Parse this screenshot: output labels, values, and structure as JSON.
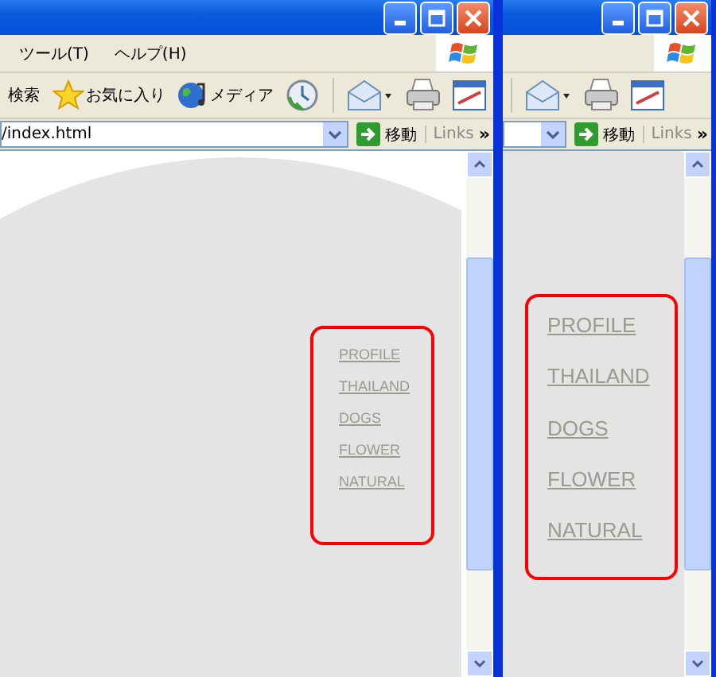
{
  "windows": [
    {
      "kind": "narrow",
      "menu": [
        "ツール(T)",
        "ヘルプ(H)"
      ],
      "toolbar": [
        {
          "kind": "search",
          "label": "検索"
        },
        {
          "kind": "favorites",
          "label": "お気に入り"
        },
        {
          "kind": "media",
          "label": "メディア"
        },
        {
          "kind": "history"
        },
        {
          "kind": "separator"
        },
        {
          "kind": "mail"
        },
        {
          "kind": "print"
        },
        {
          "kind": "edit"
        }
      ],
      "address": "/index.html",
      "go": "移動",
      "links": "Links",
      "chevron": "»",
      "nav": [
        "PROFILE",
        "THAILAND",
        "DOGS",
        "FLOWER",
        "NATURAL"
      ]
    },
    {
      "kind": "wide",
      "toolbar": [
        {
          "kind": "separator"
        },
        {
          "kind": "mail"
        },
        {
          "kind": "print"
        },
        {
          "kind": "edit"
        }
      ],
      "go": "移動",
      "links": "Links",
      "chevron": "»",
      "nav": [
        "PROFILE",
        "THAILAND",
        "DOGS",
        "FLOWER",
        "NATURAL"
      ]
    }
  ]
}
